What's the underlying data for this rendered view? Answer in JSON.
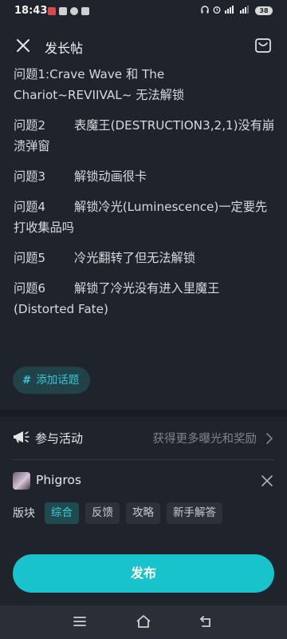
{
  "status_bar": {
    "time": "18:43",
    "battery": "38"
  },
  "header": {
    "title": "发长帖"
  },
  "questions": [
    {
      "label": "问题1:",
      "text": "Crave Wave 和 The Chariot~REVIIVAL~ 无法解锁"
    },
    {
      "label": "问题2",
      "text": "表魔王(DESTRUCTION3,2,1)没有崩溃弹窗"
    },
    {
      "label": "问题3",
      "text": "解锁动画很卡"
    },
    {
      "label": "问题4",
      "text": "解锁冷光(Luminescence)一定要先打收集品吗"
    },
    {
      "label": "问题5",
      "text": "冷光翻转了但无法解锁"
    },
    {
      "label": "问题6",
      "text": "解锁了冷光没有进入里魔王(Distorted Fate)"
    }
  ],
  "topic_button": {
    "icon": "#",
    "label": "添加话题"
  },
  "activity": {
    "label": "参与活动",
    "hint": "获得更多曝光和奖励"
  },
  "game": {
    "name": "Phigros"
  },
  "section": {
    "label": "版块",
    "tags": [
      "综合",
      "反馈",
      "攻略",
      "新手解答"
    ]
  },
  "publish_button": {
    "label": "发布"
  },
  "colors": {
    "accent": "#19c3cc",
    "background": "#1f232b"
  }
}
